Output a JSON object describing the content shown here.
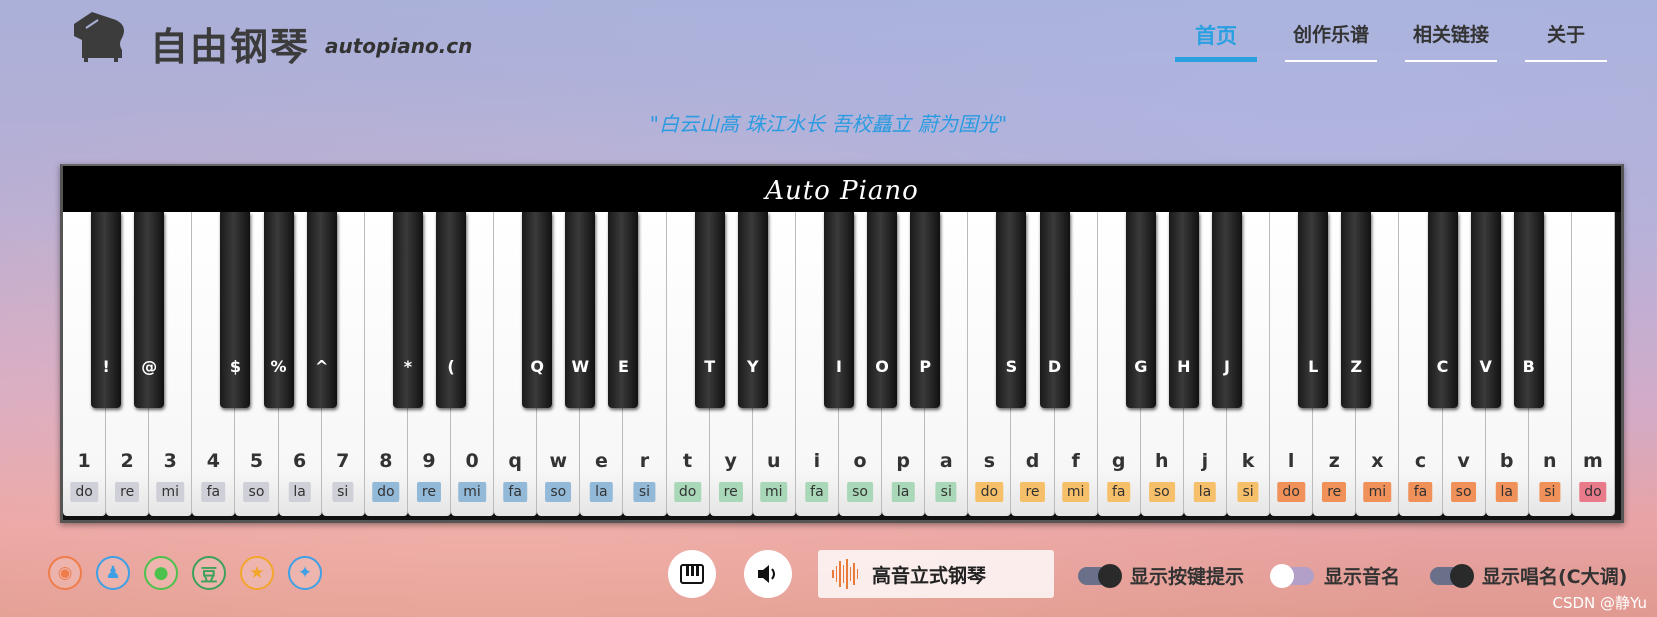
{
  "header": {
    "brand": "自由钢琴",
    "domain": "autopiano.cn",
    "nav": [
      {
        "label": "首页",
        "active": true
      },
      {
        "label": "创作乐谱",
        "active": false
      },
      {
        "label": "相关链接",
        "active": false
      },
      {
        "label": "关于",
        "active": false
      }
    ]
  },
  "motto": "\"白云山高 珠江水长 吾校矗立 蔚为国光\"",
  "piano": {
    "title": "Auto Piano",
    "white_keys": [
      {
        "key": "1",
        "sol": "do",
        "color": "#cfcfd8"
      },
      {
        "key": "2",
        "sol": "re",
        "color": "#cfcfd8"
      },
      {
        "key": "3",
        "sol": "mi",
        "color": "#cfcfd8"
      },
      {
        "key": "4",
        "sol": "fa",
        "color": "#cfcfd8"
      },
      {
        "key": "5",
        "sol": "so",
        "color": "#cfcfd8"
      },
      {
        "key": "6",
        "sol": "la",
        "color": "#cfcfd8"
      },
      {
        "key": "7",
        "sol": "si",
        "color": "#cfcfd8"
      },
      {
        "key": "8",
        "sol": "do",
        "color": "#93b9d9"
      },
      {
        "key": "9",
        "sol": "re",
        "color": "#93b9d9"
      },
      {
        "key": "0",
        "sol": "mi",
        "color": "#93b9d9"
      },
      {
        "key": "q",
        "sol": "fa",
        "color": "#93b9d9"
      },
      {
        "key": "w",
        "sol": "so",
        "color": "#93b9d9"
      },
      {
        "key": "e",
        "sol": "la",
        "color": "#93b9d9"
      },
      {
        "key": "r",
        "sol": "si",
        "color": "#93b9d9"
      },
      {
        "key": "t",
        "sol": "do",
        "color": "#a9d8b8"
      },
      {
        "key": "y",
        "sol": "re",
        "color": "#a9d8b8"
      },
      {
        "key": "u",
        "sol": "mi",
        "color": "#a9d8b8"
      },
      {
        "key": "i",
        "sol": "fa",
        "color": "#a9d8b8"
      },
      {
        "key": "o",
        "sol": "so",
        "color": "#a9d8b8"
      },
      {
        "key": "p",
        "sol": "la",
        "color": "#a9d8b8"
      },
      {
        "key": "a",
        "sol": "si",
        "color": "#a9d8b8"
      },
      {
        "key": "s",
        "sol": "do",
        "color": "#f6c06a"
      },
      {
        "key": "d",
        "sol": "re",
        "color": "#f6c06a"
      },
      {
        "key": "f",
        "sol": "mi",
        "color": "#f6c06a"
      },
      {
        "key": "g",
        "sol": "fa",
        "color": "#f6c06a"
      },
      {
        "key": "h",
        "sol": "so",
        "color": "#f6c06a"
      },
      {
        "key": "j",
        "sol": "la",
        "color": "#f6c06a"
      },
      {
        "key": "k",
        "sol": "si",
        "color": "#f6c06a"
      },
      {
        "key": "l",
        "sol": "do",
        "color": "#f0915a"
      },
      {
        "key": "z",
        "sol": "re",
        "color": "#f0915a"
      },
      {
        "key": "x",
        "sol": "mi",
        "color": "#f0915a"
      },
      {
        "key": "c",
        "sol": "fa",
        "color": "#f0915a"
      },
      {
        "key": "v",
        "sol": "so",
        "color": "#f0915a"
      },
      {
        "key": "b",
        "sol": "la",
        "color": "#f0915a"
      },
      {
        "key": "n",
        "sol": "si",
        "color": "#f0915a"
      },
      {
        "key": "m",
        "sol": "do",
        "color": "#e87a8a"
      }
    ],
    "black_keys": [
      {
        "key": "!",
        "after": 0
      },
      {
        "key": "@",
        "after": 1
      },
      {
        "key": "$",
        "after": 3
      },
      {
        "key": "%",
        "after": 4
      },
      {
        "key": "^",
        "after": 5
      },
      {
        "key": "*",
        "after": 7
      },
      {
        "key": "(",
        "after": 8
      },
      {
        "key": "Q",
        "after": 10
      },
      {
        "key": "W",
        "after": 11
      },
      {
        "key": "E",
        "after": 12
      },
      {
        "key": "T",
        "after": 14
      },
      {
        "key": "Y",
        "after": 15
      },
      {
        "key": "I",
        "after": 17
      },
      {
        "key": "O",
        "after": 18
      },
      {
        "key": "P",
        "after": 19
      },
      {
        "key": "S",
        "after": 21
      },
      {
        "key": "D",
        "after": 22
      },
      {
        "key": "G",
        "after": 24
      },
      {
        "key": "H",
        "after": 25
      },
      {
        "key": "J",
        "after": 26
      },
      {
        "key": "L",
        "after": 28
      },
      {
        "key": "Z",
        "after": 29
      },
      {
        "key": "C",
        "after": 31
      },
      {
        "key": "V",
        "after": 32
      },
      {
        "key": "B",
        "after": 33
      }
    ]
  },
  "footer": {
    "social": [
      {
        "name": "weibo-icon",
        "glyph": "◉",
        "color": "#f07c4a"
      },
      {
        "name": "qq-icon",
        "glyph": "♟",
        "color": "#3fa0e6"
      },
      {
        "name": "wechat-icon",
        "glyph": "●",
        "color": "#4cc24c"
      },
      {
        "name": "douban-icon",
        "glyph": "豆",
        "color": "#3ca15a"
      },
      {
        "name": "favorite-icon",
        "glyph": "★",
        "color": "#f3a62c"
      },
      {
        "name": "twitter-icon",
        "glyph": "✦",
        "color": "#3fa0e6"
      }
    ],
    "instrument": "高音立式钢琴",
    "toggles": [
      {
        "label": "显示按键提示",
        "on": true
      },
      {
        "label": "显示音名",
        "on": false
      },
      {
        "label": "显示唱名(C大调)",
        "on": true
      }
    ],
    "watermark": "CSDN @静Yu"
  }
}
